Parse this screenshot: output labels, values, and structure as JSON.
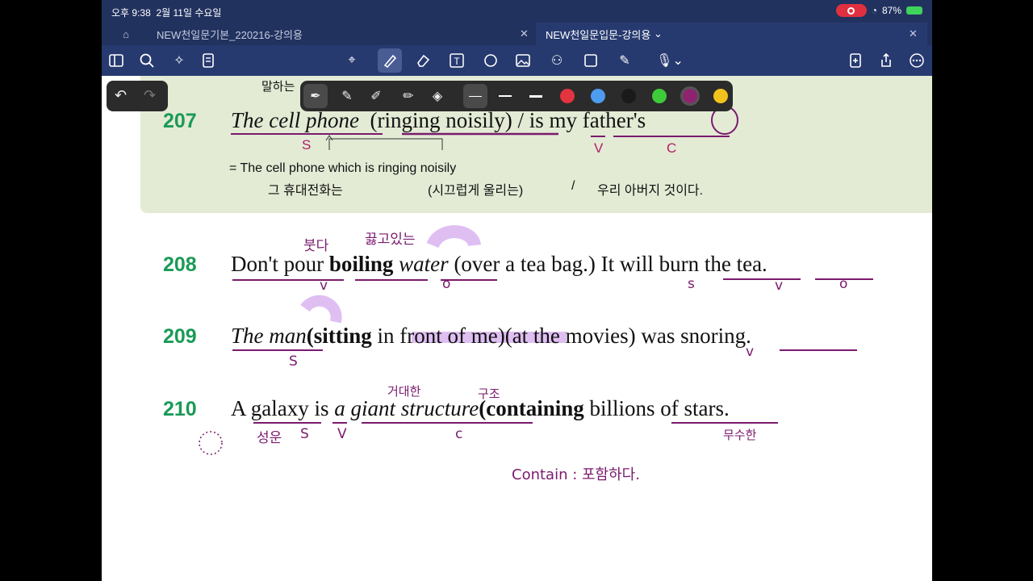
{
  "status": {
    "time": "오후 9:38",
    "date": "2월 11일 수요일",
    "battery": "87%"
  },
  "tabs": [
    {
      "label": "NEW천일문기본_220216-강의용"
    },
    {
      "label": "NEW천일문입문-강의용"
    }
  ],
  "sentences": {
    "s207": {
      "num": "207",
      "subj": "The cell phone",
      "part": "(ringing noisily)",
      "slash": "/",
      "verb": "is",
      "comp": "my father's",
      "mark_s": "S",
      "mark_v": "V",
      "mark_c": "C",
      "eq": "= The cell phone which is ringing noisily",
      "kor1": "그 휴대전화는",
      "kor2": "(시끄럽게 울리는)",
      "kor3": "/",
      "kor4": "우리 아버지 것이다.",
      "top_text": "말하는"
    },
    "s208": {
      "num": "208",
      "w1": "Don't",
      "w2": "pour",
      "w3": "boiling",
      "w4": "water",
      "w5": "(over",
      "w6": "a tea bag.)",
      "w7": "It",
      "w8": "will burn",
      "w9": "the tea."
    },
    "s209": {
      "num": "209",
      "w1": "The man",
      "w2": "(sitting",
      "w3": "in front of me)",
      "w4": "(at the movies)",
      "w5": "was",
      "w6": "snoring."
    },
    "s210": {
      "num": "210",
      "w1": "A galaxy",
      "w2": "is",
      "w3": "a giant structure",
      "w4": "(containing",
      "w5": "billions of",
      "w6": "stars."
    }
  },
  "handwriting": {
    "h208a": "붓다",
    "h208b": "끓고있는",
    "h208v": "v",
    "h208o": "o",
    "h208s": "s",
    "h208v2": "v",
    "h208o2": "o",
    "h209s": "S",
    "h209v": "v",
    "h210a": "거대한",
    "h210b": "구조",
    "h210c": "성운",
    "h210s": "S",
    "h210v": "V",
    "h210cc": "c",
    "h210d": "무수한",
    "contain": "Contain : 포함하다."
  },
  "colors": {
    "accent": "#1b9a56",
    "toolbar": "#273a70",
    "ink": "#7a1a6e",
    "highlight": "#c58be8"
  }
}
